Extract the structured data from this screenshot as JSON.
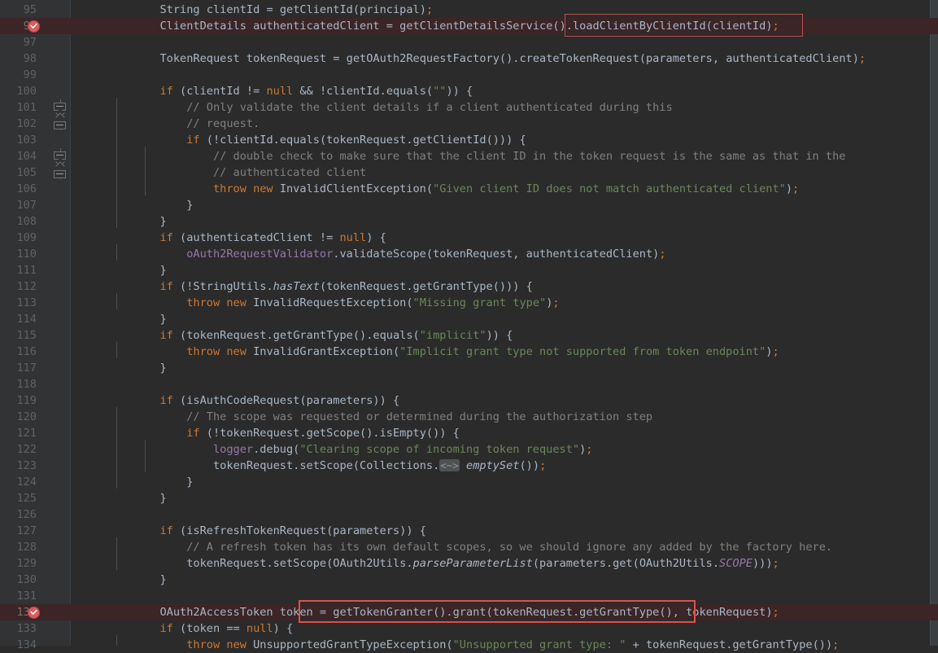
{
  "editor": {
    "app": "code-editor",
    "theme": "darcula",
    "background": "#2b2b2b",
    "gutter_background": "#313335",
    "line_number_color": "#606366",
    "breakpoint_line_background": "#3b2526",
    "breakpoint_color": "#db5c5c",
    "soft_box_border_color": "#b4514f",
    "hard_box_border_color": "#e04f4a",
    "first_visible_line": 95,
    "last_visible_line": 134,
    "line_height_px": 20,
    "breakpoint_lines": [
      96,
      132
    ],
    "icons": {
      "breakpoint": "breakpoint-checkmark-icon",
      "fold_collapse": "fold-collapse-icon",
      "fold_expand": "fold-expand-icon"
    },
    "inline_hint": "<~>"
  },
  "lines": [
    {
      "n": "95",
      "indent": 2,
      "text": "String clientId = getClientId(principal);"
    },
    {
      "n": "96",
      "indent": 2,
      "text": "ClientDetails authenticatedClient = getClientDetailsService().loadClientByClientId(clientId);"
    },
    {
      "n": "97",
      "indent": 0,
      "text": ""
    },
    {
      "n": "98",
      "indent": 2,
      "text": "TokenRequest tokenRequest = getOAuth2RequestFactory().createTokenRequest(parameters, authenticatedClient);"
    },
    {
      "n": "99",
      "indent": 0,
      "text": ""
    },
    {
      "n": "100",
      "indent": 2,
      "text": "if (clientId != null && !clientId.equals(\"\")) {"
    },
    {
      "n": "101",
      "indent": 3,
      "text": "// Only validate the client details if a client authenticated during this"
    },
    {
      "n": "102",
      "indent": 3,
      "text": "// request."
    },
    {
      "n": "103",
      "indent": 3,
      "text": "if (!clientId.equals(tokenRequest.getClientId())) {"
    },
    {
      "n": "104",
      "indent": 4,
      "text": "// double check to make sure that the client ID in the token request is the same as that in the"
    },
    {
      "n": "105",
      "indent": 4,
      "text": "// authenticated client"
    },
    {
      "n": "106",
      "indent": 4,
      "text": "throw new InvalidClientException(\"Given client ID does not match authenticated client\");"
    },
    {
      "n": "107",
      "indent": 3,
      "text": "}"
    },
    {
      "n": "108",
      "indent": 2,
      "text": "}"
    },
    {
      "n": "109",
      "indent": 2,
      "text": "if (authenticatedClient != null) {"
    },
    {
      "n": "110",
      "indent": 3,
      "text": "oAuth2RequestValidator.validateScope(tokenRequest, authenticatedClient);"
    },
    {
      "n": "111",
      "indent": 2,
      "text": "}"
    },
    {
      "n": "112",
      "indent": 2,
      "text": "if (!StringUtils.hasText(tokenRequest.getGrantType())) {"
    },
    {
      "n": "113",
      "indent": 3,
      "text": "throw new InvalidRequestException(\"Missing grant type\");"
    },
    {
      "n": "114",
      "indent": 2,
      "text": "}"
    },
    {
      "n": "115",
      "indent": 2,
      "text": "if (tokenRequest.getGrantType().equals(\"implicit\")) {"
    },
    {
      "n": "116",
      "indent": 3,
      "text": "throw new InvalidGrantException(\"Implicit grant type not supported from token endpoint\");"
    },
    {
      "n": "117",
      "indent": 2,
      "text": "}"
    },
    {
      "n": "118",
      "indent": 0,
      "text": ""
    },
    {
      "n": "119",
      "indent": 2,
      "text": "if (isAuthCodeRequest(parameters)) {"
    },
    {
      "n": "120",
      "indent": 3,
      "text": "// The scope was requested or determined during the authorization step"
    },
    {
      "n": "121",
      "indent": 3,
      "text": "if (!tokenRequest.getScope().isEmpty()) {"
    },
    {
      "n": "122",
      "indent": 4,
      "text": "logger.debug(\"Clearing scope of incoming token request\");"
    },
    {
      "n": "123",
      "indent": 4,
      "text": "tokenRequest.setScope(Collections.<~> emptySet());"
    },
    {
      "n": "124",
      "indent": 3,
      "text": "}"
    },
    {
      "n": "125",
      "indent": 2,
      "text": "}"
    },
    {
      "n": "126",
      "indent": 0,
      "text": ""
    },
    {
      "n": "127",
      "indent": 2,
      "text": "if (isRefreshTokenRequest(parameters)) {"
    },
    {
      "n": "128",
      "indent": 3,
      "text": "// A refresh token has its own default scopes, so we should ignore any added by the factory here."
    },
    {
      "n": "129",
      "indent": 3,
      "text": "tokenRequest.setScope(OAuth2Utils.parseParameterList(parameters.get(OAuth2Utils.SCOPE)));"
    },
    {
      "n": "130",
      "indent": 2,
      "text": "}"
    },
    {
      "n": "131",
      "indent": 0,
      "text": ""
    },
    {
      "n": "132",
      "indent": 2,
      "text": "OAuth2AccessToken token = getTokenGranter().grant(tokenRequest.getGrantType(), tokenRequest);"
    },
    {
      "n": "133",
      "indent": 2,
      "text": "if (token == null) {"
    },
    {
      "n": "134",
      "indent": 3,
      "text": "throw new UnsupportedGrantTypeException(\"Unsupported grant type: \" + tokenRequest.getGrantType());"
    }
  ],
  "annotations": [
    {
      "name": "call-highlight-load-client",
      "line": 96,
      "style": "soft",
      "text": ".loadClientByClientId(clientId);"
    },
    {
      "name": "call-highlight-grant",
      "line": 132,
      "style": "hard",
      "text": "getTokenGranter().grant(tokenRequest.getGrantType(),"
    }
  ]
}
